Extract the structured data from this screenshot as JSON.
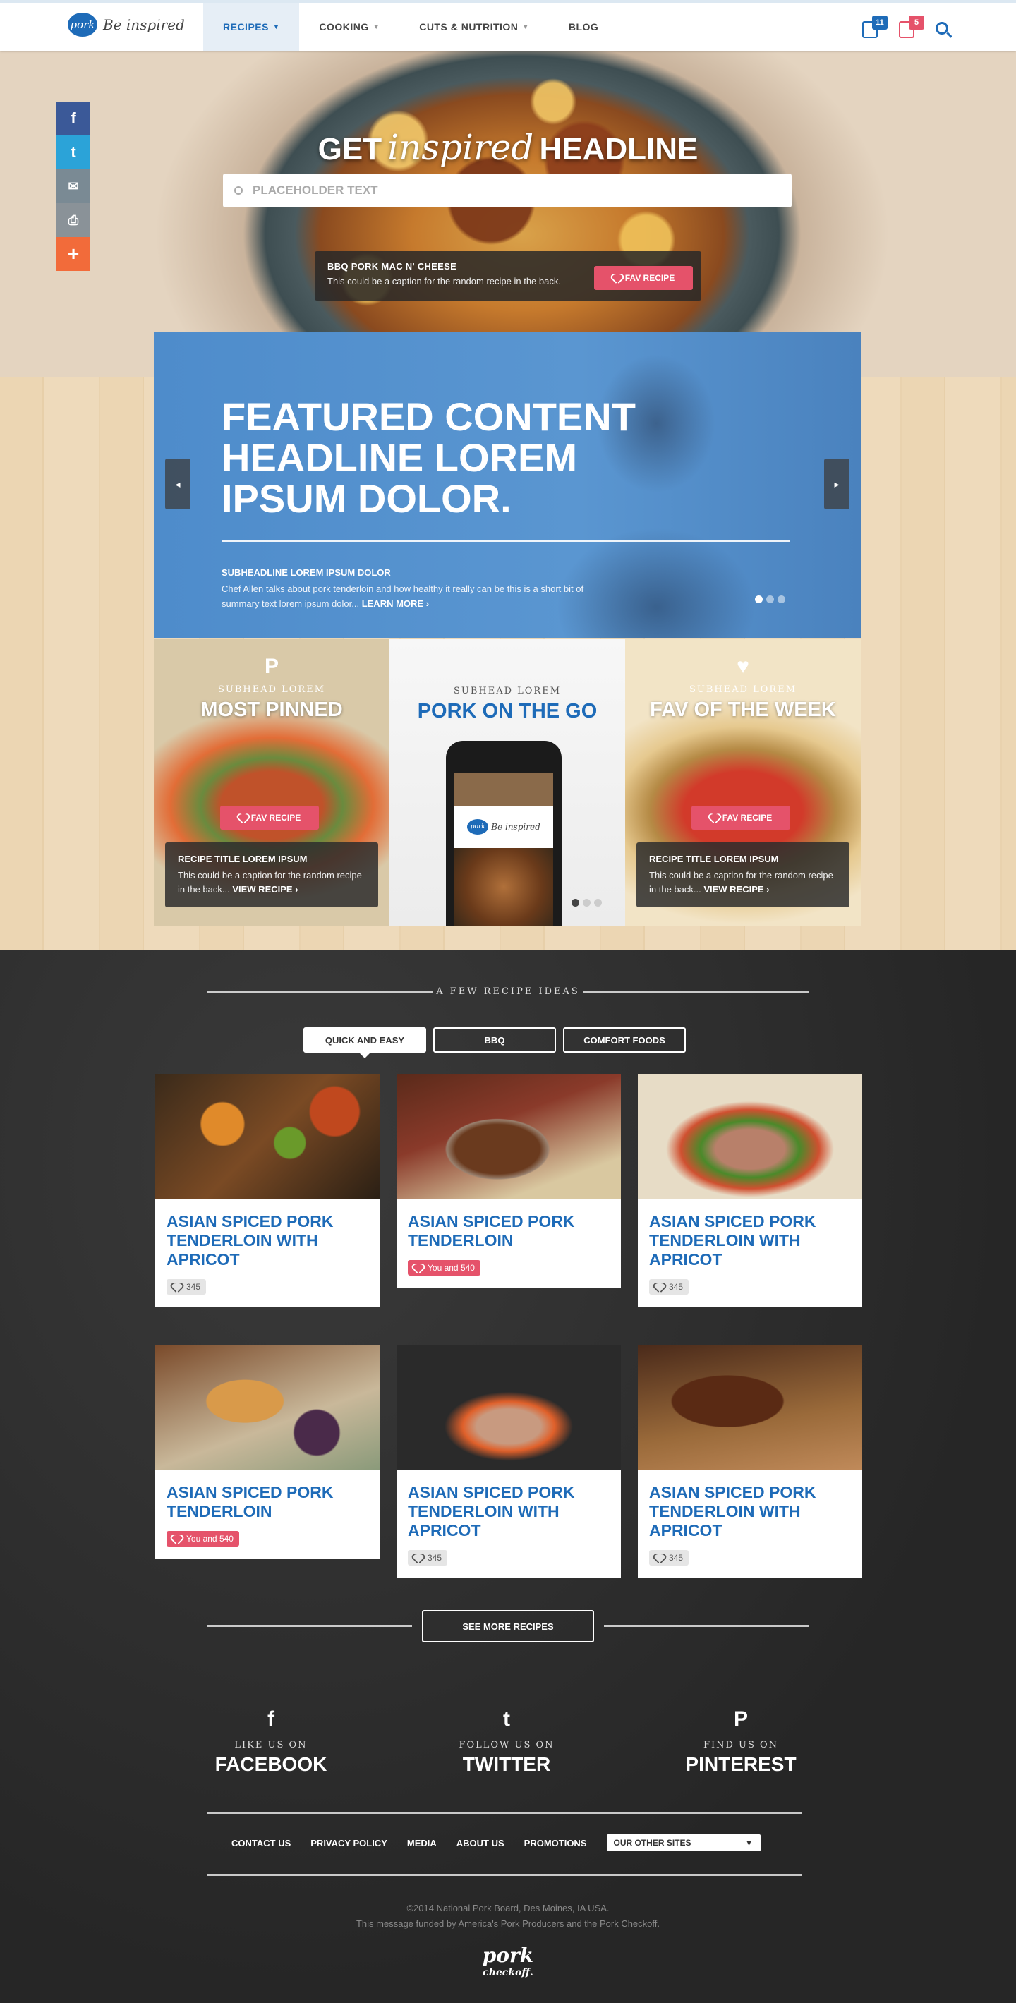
{
  "header": {
    "logo_badge": "pork",
    "logo_tagline": "Be inspired",
    "nav": [
      {
        "label": "RECIPES"
      },
      {
        "label": "COOKING"
      },
      {
        "label": "CUTS & NUTRITION"
      },
      {
        "label": "BLOG"
      }
    ],
    "list_badge": "11",
    "check_badge": "5"
  },
  "social_share": {
    "facebook": "f",
    "twitter": "t",
    "email": "✉",
    "print": "⎙",
    "more": "+"
  },
  "hero": {
    "title_pre": "GET",
    "title_script": "inspired",
    "title_post": "HEADLINE",
    "search_placeholder": "PLACEHOLDER TEXT",
    "caption_title": "BBQ PORK MAC N' CHEESE",
    "caption_text": "This could be a caption for the random recipe in the back.",
    "fav_label": "FAV RECIPE"
  },
  "featured": {
    "headline": "FEATURED CONTENT HEADLINE LOREM IPSUM DOLOR.",
    "subheadline": "SUBHEADLINE LOREM IPSUM DOLOR",
    "summary": "Chef Allen talks about pork tenderloin and how healthy it really can be this is a short bit of summary text lorem ipsum dolor...",
    "learn_more": "LEARN MORE ›",
    "prev": "◂",
    "next": "▸"
  },
  "tiles": [
    {
      "icon": "P",
      "subhead": "SUBHEAD LOREM",
      "headline": "MOST PINNED",
      "fav_label": "FAV RECIPE",
      "caption_title": "RECIPE TITLE LOREM IPSUM",
      "caption_text": "This could be a caption for the random recipe in the back...",
      "view": "VIEW RECIPE ›"
    },
    {
      "subhead": "SUBHEAD LOREM",
      "headline": "PORK ON THE GO",
      "phone_badge": "pork",
      "phone_tagline": "Be inspired"
    },
    {
      "icon": "♥",
      "subhead": "SUBHEAD LOREM",
      "headline": "FAV OF THE WEEK",
      "fav_label": "FAV RECIPE",
      "caption_title": "RECIPE TITLE LOREM IPSUM",
      "caption_text": "This could be a caption for the random recipe in the back...",
      "view": "VIEW RECIPE ›"
    }
  ],
  "recipes_section": {
    "label": "A FEW RECIPE IDEAS",
    "filters": [
      "QUICK AND EASY",
      "BBQ",
      "COMFORT FOODS"
    ],
    "cards": [
      {
        "title": "ASIAN SPICED PORK TENDERLOIN WITH APRICOT",
        "count": "345",
        "liked": false
      },
      {
        "title": "ASIAN SPICED PORK TENDERLOIN",
        "count": "You and 540",
        "liked": true
      },
      {
        "title": "ASIAN SPICED PORK TENDERLOIN WITH APRICOT",
        "count": "345",
        "liked": false
      },
      {
        "title": "ASIAN SPICED PORK TENDERLOIN",
        "count": "You and 540",
        "liked": true
      },
      {
        "title": "ASIAN SPICED PORK TENDERLOIN WITH APRICOT",
        "count": "345",
        "liked": false
      },
      {
        "title": "ASIAN SPICED PORK TENDERLOIN WITH APRICOT",
        "count": "345",
        "liked": false
      }
    ],
    "see_more": "SEE MORE RECIPES"
  },
  "footer": {
    "social": [
      {
        "icon": "f",
        "sub": "LIKE US ON",
        "name": "FACEBOOK"
      },
      {
        "icon": "t",
        "sub": "FOLLOW US ON",
        "name": "TWITTER"
      },
      {
        "icon": "P",
        "sub": "FIND US ON",
        "name": "PINTEREST"
      }
    ],
    "links": [
      "CONTACT US",
      "PRIVACY POLICY",
      "MEDIA",
      "ABOUT US",
      "PROMOTIONS"
    ],
    "other_sites": "OUR OTHER SITES",
    "copyright": "©2014 National Pork Board, Des Moines, IA USA.",
    "funded": "This message funded by America's Pork Producers and the Pork Checkoff.",
    "logo_main": "pork",
    "logo_sub": "checkoff."
  },
  "colors": {
    "brand_blue": "#1e6bb8",
    "accent_pink": "#e5526a",
    "facebook": "#3b5998",
    "twitter": "#2ba3d8",
    "email": "#7a8a94",
    "print": "#8a9298",
    "more": "#f26b3a"
  }
}
